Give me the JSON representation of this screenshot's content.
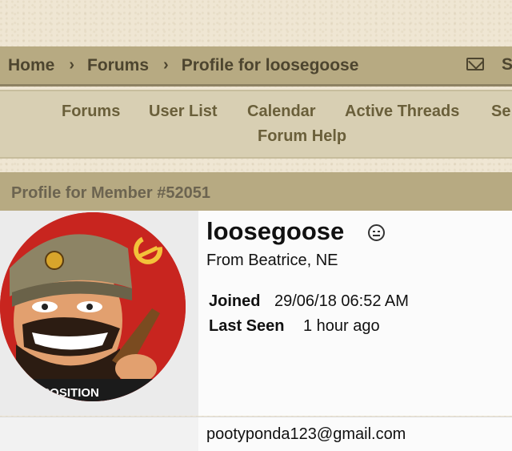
{
  "breadcrumb": {
    "items": [
      "Home",
      "Forums",
      "Profile for loosegoose"
    ],
    "separator": "›",
    "truncated_item": "S"
  },
  "nav": {
    "items": [
      "Forums",
      "User List",
      "Calendar",
      "Active Threads",
      "Se",
      "Forum Help"
    ]
  },
  "section": {
    "title": "Profile for Member #52051"
  },
  "profile": {
    "username": "loosegoose",
    "location": "From Beatrice, NE",
    "joined_label": "Joined",
    "joined_value": "29/06/18 06:52 AM",
    "last_seen_label": "Last Seen",
    "last_seen_value": "1 hour ago",
    "email": "pootyponda123@gmail.com",
    "avatar_text": "S EXPOSITION"
  },
  "icons": {
    "mail": "mail-icon",
    "status": "neutral-face-icon",
    "chevron": "chevron-right-icon"
  },
  "colors": {
    "header": "#b7aa82",
    "nav": "#d8cfb3",
    "avatar_bg": "#c8251f",
    "text_dark": "#4d452f"
  }
}
